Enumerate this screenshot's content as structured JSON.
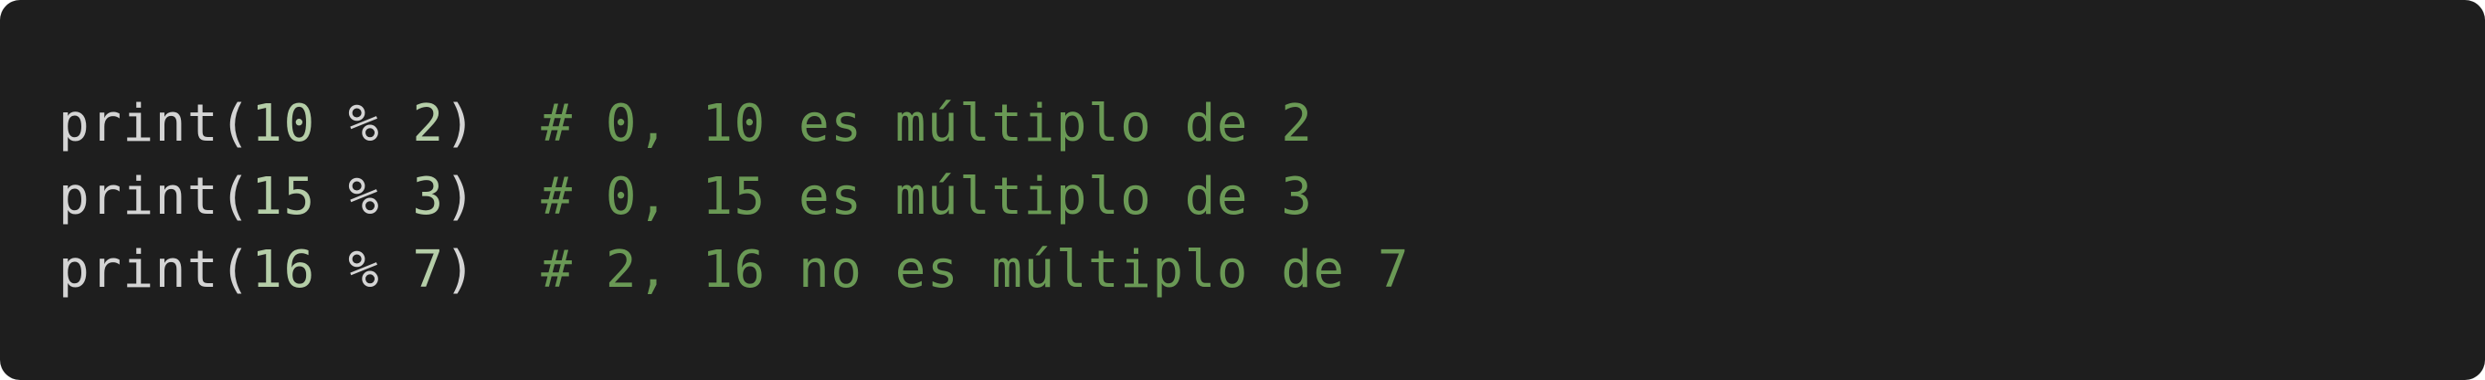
{
  "code": {
    "language": "python",
    "lines": [
      {
        "fn": "print",
        "open": "(",
        "left": "10",
        "op": " % ",
        "right": "2",
        "close": ")",
        "gap": "  ",
        "comment": "# 0, 10 es múltiplo de 2"
      },
      {
        "fn": "print",
        "open": "(",
        "left": "15",
        "op": " % ",
        "right": "3",
        "close": ")",
        "gap": "  ",
        "comment": "# 0, 15 es múltiplo de 3"
      },
      {
        "fn": "print",
        "open": "(",
        "left": "16",
        "op": " % ",
        "right": "7",
        "close": ")",
        "gap": "  ",
        "comment": "# 2, 16 no es múltiplo de 7"
      }
    ]
  },
  "colors": {
    "background": "#1e1e1e",
    "default_text": "#d4d4d4",
    "number": "#b5cea8",
    "comment": "#6a9955"
  }
}
